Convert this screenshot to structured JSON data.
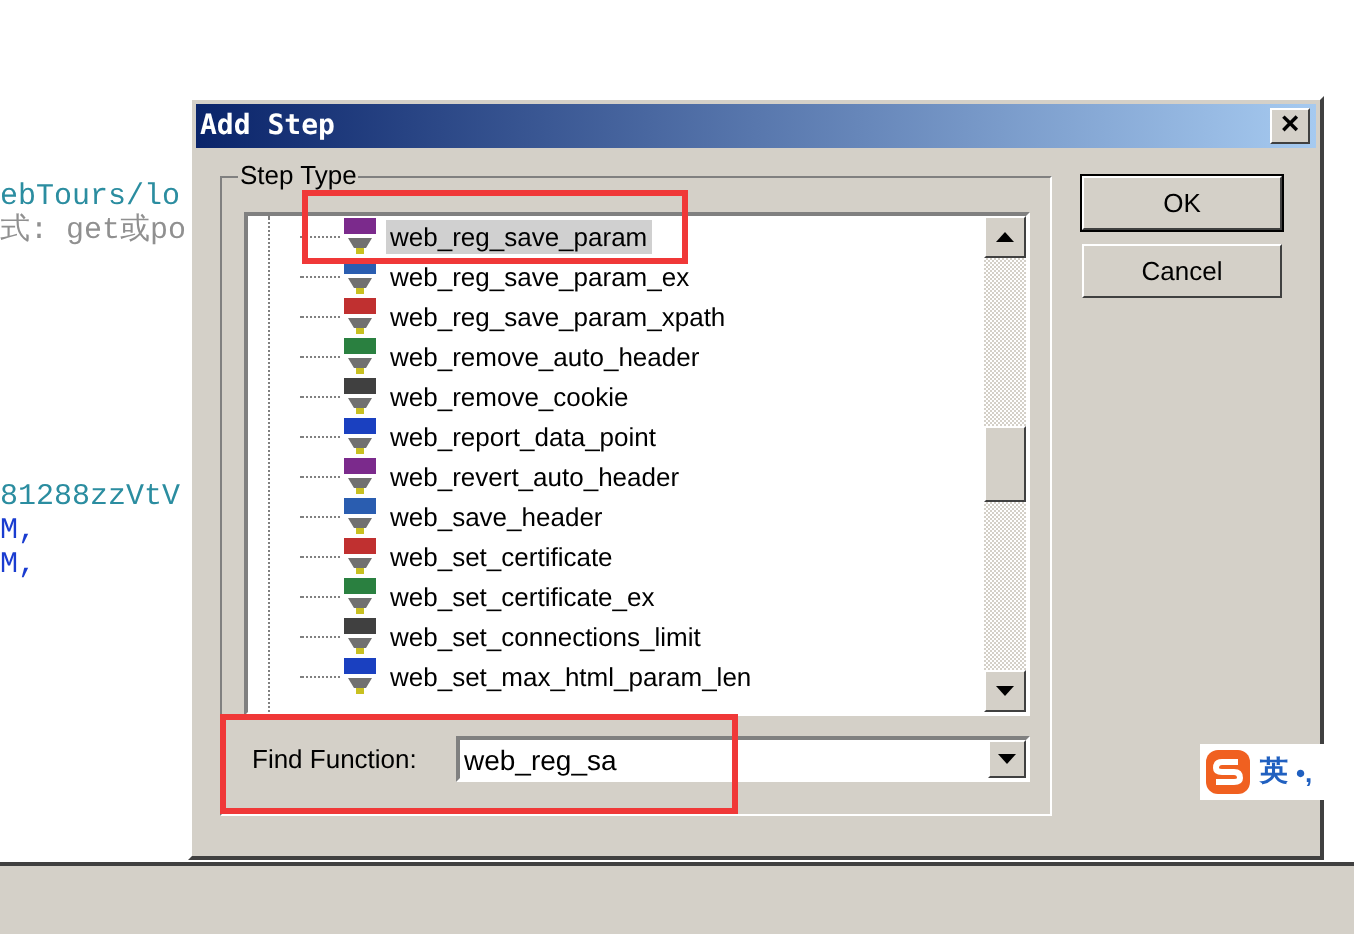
{
  "editor": {
    "lines": [
      {
        "text": "ebTours/lo",
        "kind": "string"
      },
      {
        "text": "式: get或po",
        "kind": "comment"
      },
      {
        "text": "81288zzVtV",
        "kind": "string"
      },
      {
        "text": "M,",
        "kind": "keyword"
      },
      {
        "text": "M,",
        "kind": "keyword"
      }
    ]
  },
  "dialog": {
    "title": "Add Step",
    "close": "×",
    "group_label": "Step Type",
    "items": [
      {
        "label": "web_reg_save_param",
        "selected": true
      },
      {
        "label": "web_reg_save_param_ex",
        "selected": false
      },
      {
        "label": "web_reg_save_param_xpath",
        "selected": false
      },
      {
        "label": "web_remove_auto_header",
        "selected": false
      },
      {
        "label": "web_remove_cookie",
        "selected": false
      },
      {
        "label": "web_report_data_point",
        "selected": false
      },
      {
        "label": "web_revert_auto_header",
        "selected": false
      },
      {
        "label": "web_save_header",
        "selected": false
      },
      {
        "label": "web_set_certificate",
        "selected": false
      },
      {
        "label": "web_set_certificate_ex",
        "selected": false
      },
      {
        "label": "web_set_connections_limit",
        "selected": false
      },
      {
        "label": "web_set_max_html_param_len",
        "selected": false
      }
    ],
    "find_label": "Find Function:",
    "find_value": "web_reg_sa",
    "buttons": [
      "OK",
      "Cancel"
    ]
  },
  "ime": {
    "mode": "英",
    "punct": "•,"
  }
}
